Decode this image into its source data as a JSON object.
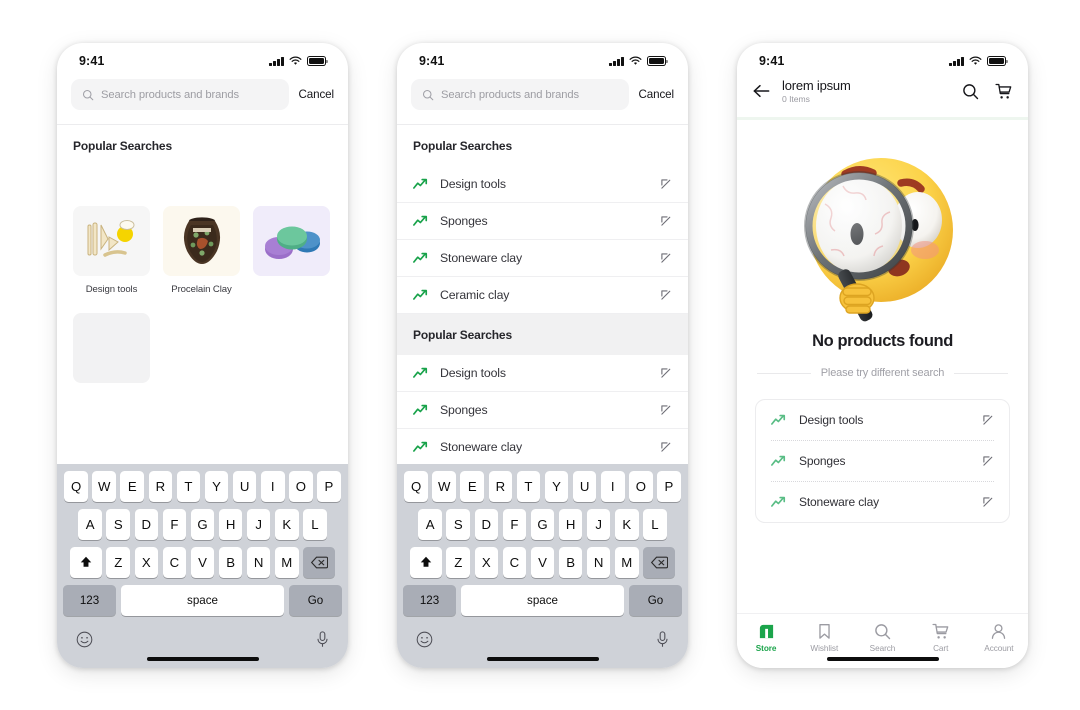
{
  "screens": {
    "phone1": {
      "status": {
        "time": "9:41",
        "signal_icon": "cellular-bars-icon",
        "wifi_icon": "wifi-icon",
        "battery_icon": "battery-icon"
      },
      "search": {
        "placeholder": "Search products and brands",
        "value": "",
        "cancel_label": "Cancel",
        "search_icon": "search-icon"
      },
      "section_title": "Popular Searches",
      "products": [
        {
          "label": "Design tools",
          "thumb": "design-tools-image"
        },
        {
          "label": "Procelain Clay",
          "thumb": "porcelain-vase-image"
        },
        {
          "label": "",
          "thumb": "clay-discs-image"
        },
        {
          "label": "",
          "thumb": "empty-placeholder"
        }
      ],
      "keyboard": {
        "row1": [
          "Q",
          "W",
          "E",
          "R",
          "T",
          "Y",
          "U",
          "I",
          "O",
          "P"
        ],
        "row2": [
          "A",
          "S",
          "D",
          "F",
          "G",
          "H",
          "J",
          "K",
          "L"
        ],
        "row3": [
          "Z",
          "X",
          "C",
          "V",
          "B",
          "N",
          "M"
        ],
        "shift_icon": "shift-up-icon",
        "backspace_icon": "backspace-icon",
        "numbers_label": "123",
        "space_label": "space",
        "return_label": "Go",
        "emoji_icon": "emoji-smiley-icon",
        "mic_icon": "microphone-icon"
      }
    },
    "phone2": {
      "status": {
        "time": "9:41"
      },
      "search": {
        "placeholder": "Search products and brands",
        "value": "",
        "cancel_label": "Cancel"
      },
      "section1_title": "Popular Searches",
      "section1_items": [
        "Design tools",
        "Sponges",
        "Stoneware clay",
        "Ceramic clay"
      ],
      "section2_title": "Popular Searches",
      "section2_items": [
        "Design tools",
        "Sponges",
        "Stoneware clay"
      ],
      "trend_icon": "trending-up-icon",
      "insert_icon": "arrow-up-left-icon",
      "keyboard": {
        "row1": [
          "Q",
          "W",
          "E",
          "R",
          "T",
          "Y",
          "U",
          "I",
          "O",
          "P"
        ],
        "row2": [
          "A",
          "S",
          "D",
          "F",
          "G",
          "H",
          "J",
          "K",
          "L"
        ],
        "row3": [
          "Z",
          "X",
          "C",
          "V",
          "B",
          "N",
          "M"
        ],
        "numbers_label": "123",
        "space_label": "space",
        "return_label": "Go"
      }
    },
    "phone3": {
      "status": {
        "time": "9:41"
      },
      "header": {
        "back_icon": "back-arrow-icon",
        "title": "lorem ipsum",
        "subtitle": "0 Items",
        "search_icon": "search-icon",
        "cart_icon": "cart-icon"
      },
      "empty": {
        "mascot": "emoji-with-magnifier-illustration",
        "title": "No products found",
        "subtitle": "Please try different search"
      },
      "suggestions": [
        "Design tools",
        "Sponges",
        "Stoneware clay"
      ],
      "trend_icon": "trending-up-icon",
      "insert_icon": "arrow-up-left-icon",
      "tabs": [
        {
          "label": "Store",
          "icon": "store-icon",
          "active": true
        },
        {
          "label": "Wishlist",
          "icon": "bookmark-icon",
          "active": false
        },
        {
          "label": "Search",
          "icon": "search-icon",
          "active": false
        },
        {
          "label": "Cart",
          "icon": "cart-icon",
          "active": false
        },
        {
          "label": "Account",
          "icon": "person-icon",
          "active": false
        }
      ]
    }
  },
  "colors": {
    "accent_green": "#1ba44b",
    "trend_green": "#18a24a",
    "text_dark": "#1d1d22",
    "text_muted": "#9b9ba2",
    "keyboard_bg": "#cfd2d8",
    "key_gray": "#a9adb6"
  }
}
